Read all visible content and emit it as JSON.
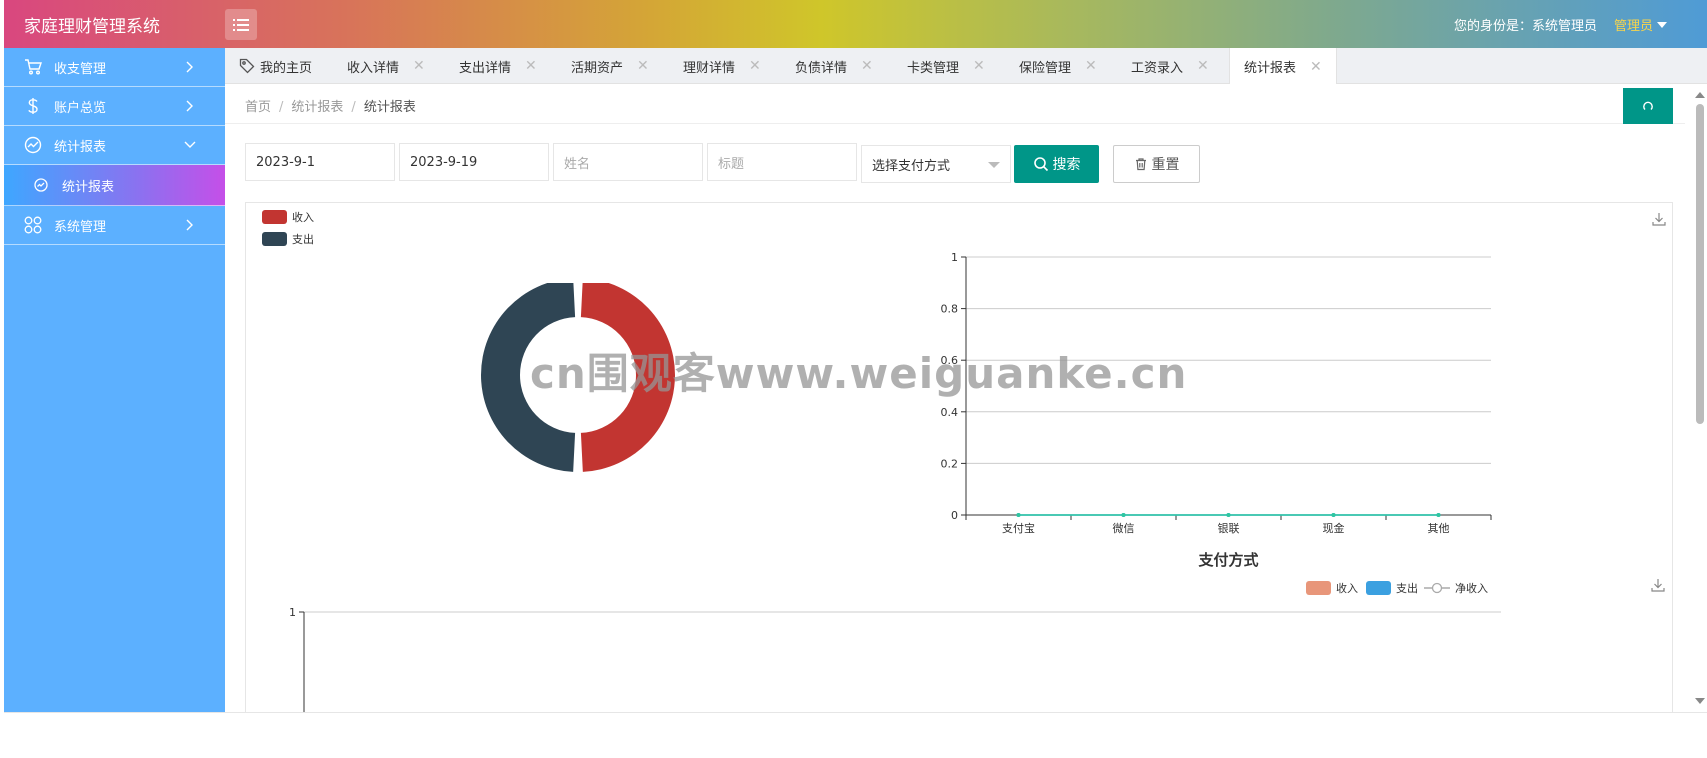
{
  "app": {
    "title": "家庭理财管理系统"
  },
  "header": {
    "identity_label": "您的身份是：系统管理员",
    "admin_label": "管理员"
  },
  "sidebar": {
    "items": [
      {
        "label": "收支管理",
        "icon": "cart-icon"
      },
      {
        "label": "账户总览",
        "icon": "dollar-icon"
      },
      {
        "label": "统计报表",
        "icon": "chart-line-icon",
        "expanded": true
      },
      {
        "label": "系统管理",
        "icon": "apps-icon"
      }
    ],
    "sub_items": [
      {
        "label": "统计报表",
        "icon": "circle-chart-icon"
      }
    ]
  },
  "tabs": [
    {
      "label": "我的主页",
      "closable": false
    },
    {
      "label": "收入详情",
      "closable": true
    },
    {
      "label": "支出详情",
      "closable": true
    },
    {
      "label": "活期资产",
      "closable": true
    },
    {
      "label": "理财详情",
      "closable": true
    },
    {
      "label": "负债详情",
      "closable": true
    },
    {
      "label": "卡类管理",
      "closable": true
    },
    {
      "label": "保险管理",
      "closable": true
    },
    {
      "label": "工资录入",
      "closable": true
    },
    {
      "label": "统计报表",
      "closable": true,
      "active": true
    }
  ],
  "breadcrumb": [
    "首页",
    "统计报表",
    "统计报表"
  ],
  "filters": {
    "start_date": "2023-9-1",
    "end_date": "2023-9-19",
    "name_placeholder": "姓名",
    "title_placeholder": "标题",
    "payment_select": "选择支付方式",
    "search_label": "搜索",
    "reset_label": "重置"
  },
  "colors": {
    "accent": "#009688",
    "income": "#c23531",
    "expense": "#2f4554",
    "sidebar": "#5cb0ff"
  },
  "watermark": "cn围观客www.weiguanke.cn",
  "chart_data": [
    {
      "type": "pie",
      "legend": [
        "收入",
        "支出"
      ],
      "values": [
        1,
        1
      ],
      "colors": [
        "#c23531",
        "#2f4554"
      ],
      "legend_position": "top-left"
    },
    {
      "type": "line",
      "categories": [
        "支付宝",
        "微信",
        "银联",
        "现金",
        "其他"
      ],
      "xlabel": "支付方式",
      "ylim": [
        0,
        1
      ],
      "yticks": [
        "0",
        "0.2",
        "0.4",
        "0.6",
        "0.8",
        "1"
      ],
      "series": [
        {
          "values": [
            0,
            0,
            0,
            0,
            0
          ]
        },
        {
          "values": [
            0,
            0,
            0,
            0,
            0
          ]
        }
      ],
      "grid": true
    },
    {
      "type": "bar",
      "legend": [
        {
          "name": "收入",
          "color": "#e8967a"
        },
        {
          "name": "支出",
          "color": "#3ba0e0"
        },
        {
          "name": "净收入",
          "color": "#aaaaaa"
        }
      ],
      "legend_position": "top-right",
      "yticks": [
        "1"
      ]
    }
  ]
}
